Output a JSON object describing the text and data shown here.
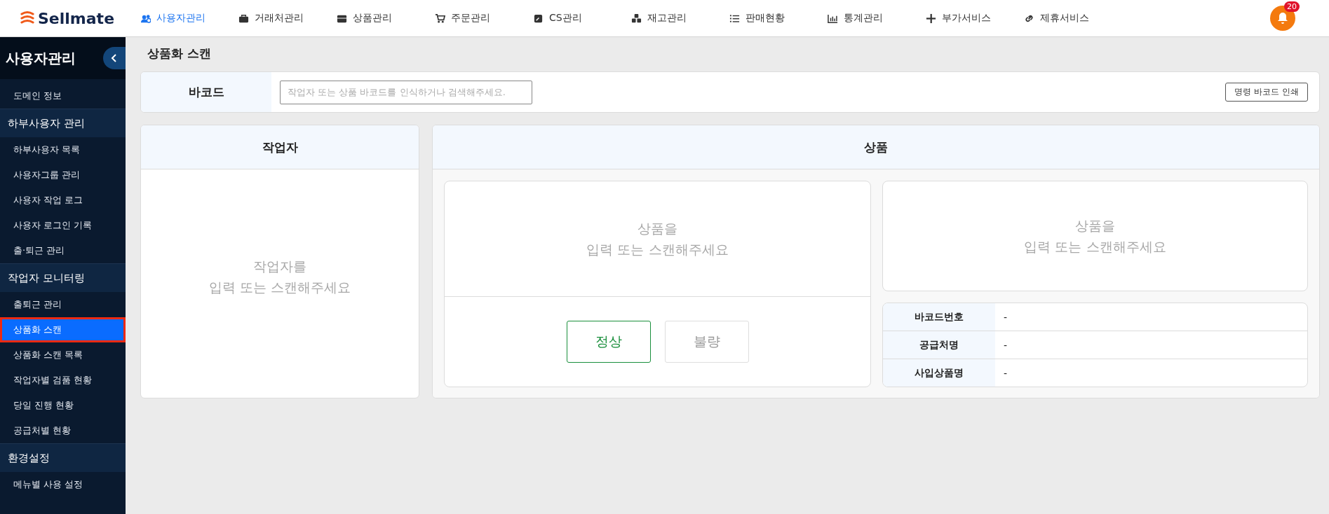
{
  "header": {
    "logo_text": "Sellmate",
    "nav": [
      {
        "label": "사용자관리",
        "kind": "users",
        "selected": true
      },
      {
        "label": "거래처관리",
        "kind": "briefcase",
        "selected": false
      },
      {
        "label": "상품관리",
        "kind": "box",
        "selected": false
      },
      {
        "label": "주문관리",
        "kind": "cart",
        "selected": false
      },
      {
        "label": "CS관리",
        "kind": "note",
        "selected": false
      },
      {
        "label": "재고관리",
        "kind": "cubes",
        "selected": false
      },
      {
        "label": "판매현황",
        "kind": "list",
        "selected": false
      },
      {
        "label": "통계관리",
        "kind": "chart",
        "selected": false
      },
      {
        "label": "부가서비스",
        "kind": "plus",
        "selected": false
      },
      {
        "label": "제휴서비스",
        "kind": "link",
        "selected": false
      }
    ],
    "notification_count": "20"
  },
  "sidebar": {
    "title": "사용자관리",
    "items": [
      {
        "label": "도메인 정보",
        "kind": "item",
        "selected": false
      },
      {
        "label": "하부사용자 관리",
        "kind": "group"
      },
      {
        "label": "하부사용자 목록",
        "kind": "item",
        "selected": false
      },
      {
        "label": "사용자그룹 관리",
        "kind": "item",
        "selected": false
      },
      {
        "label": "사용자 작업 로그",
        "kind": "item",
        "selected": false
      },
      {
        "label": "사용자 로그인 기록",
        "kind": "item",
        "selected": false
      },
      {
        "label": "출·퇴근 관리",
        "kind": "item",
        "selected": false
      },
      {
        "label": "작업자 모니터링",
        "kind": "group"
      },
      {
        "label": "출퇴근 관리",
        "kind": "item",
        "selected": false
      },
      {
        "label": "상품화 스캔",
        "kind": "item",
        "selected": true
      },
      {
        "label": "상품화 스캔 목록",
        "kind": "item",
        "selected": false
      },
      {
        "label": "작업자별 검품 현황",
        "kind": "item",
        "selected": false
      },
      {
        "label": "당일 진행 현황",
        "kind": "item",
        "selected": false
      },
      {
        "label": "공급처별 현황",
        "kind": "item",
        "selected": false
      },
      {
        "label": "환경설정",
        "kind": "group"
      },
      {
        "label": "메뉴별 사용 설정",
        "kind": "item",
        "selected": false
      }
    ]
  },
  "page_title": "상품화 스캔",
  "barcode": {
    "label": "바코드",
    "placeholder": "작업자 또는 상품 바코드를 인식하거나 검색해주세요.",
    "print_button": "명령 바코드 인쇄"
  },
  "worker_panel": {
    "title": "작업자",
    "message_lines": [
      "작업자를",
      "입력 또는 스캔해주세요"
    ]
  },
  "product_panel": {
    "title": "상품",
    "left_message_lines": [
      "상품을",
      "입력 또는 스캔해주세요"
    ],
    "buttons": [
      {
        "label": "정상",
        "disabled": false
      },
      {
        "label": "불량",
        "disabled": true
      }
    ],
    "right_message_lines": [
      "상품을",
      "입력 또는 스캔해주세요"
    ],
    "details": [
      {
        "label": "바코드번호",
        "value": "-"
      },
      {
        "label": "공급처명",
        "value": "-"
      },
      {
        "label": "사입상품명",
        "value": "-"
      }
    ]
  }
}
